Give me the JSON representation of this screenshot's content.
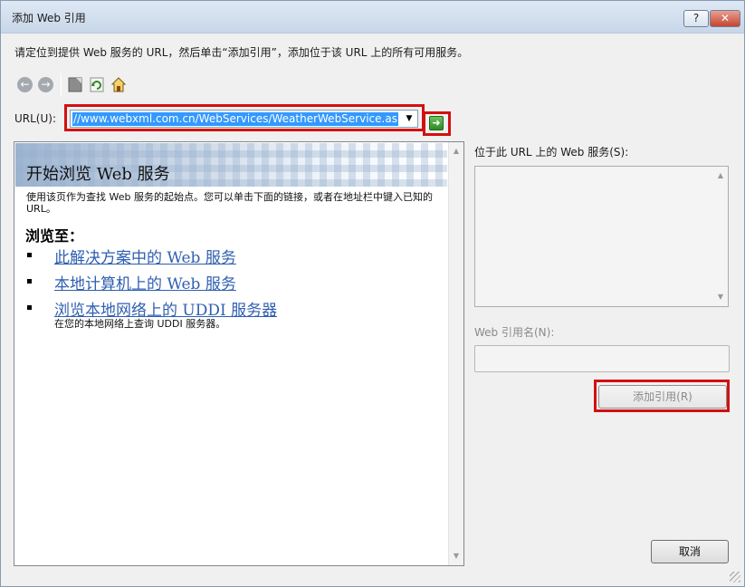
{
  "window": {
    "title": "添加 Web 引用",
    "help_glyph": "?",
    "close_glyph": "✕"
  },
  "instruction": "请定位到提供 Web 服务的 URL，然后单击“添加引用”，添加位于该 URL 上的所有可用服务。",
  "toolbar": {
    "back_glyph": "←",
    "forward_glyph": "→"
  },
  "url": {
    "label": "URL(U):",
    "value": "//www.webxml.com.cn/WebServices/WeatherWebService.asmx",
    "dropdown_glyph": "▼",
    "go_glyph": "➜"
  },
  "browser": {
    "heading": "开始浏览 Web 服务",
    "intro": "使用该页作为查找 Web 服务的起始点。您可以单击下面的链接，或者在地址栏中键入已知的 URL。",
    "browse_to": "浏览至：",
    "links": [
      {
        "label": "此解决方案中的 Web 服务"
      },
      {
        "label": "本地计算机上的 Web 服务"
      },
      {
        "label": "浏览本地网络上的 UDDI 服务器"
      }
    ],
    "link_sub": "在您的本地网络上查询 UDDI 服务器。",
    "scroll_up": "▲",
    "scroll_down": "▼"
  },
  "services": {
    "label": "位于此 URL 上的 Web 服务(S):",
    "scroll_up": "▲",
    "scroll_down": "▼"
  },
  "refname": {
    "label": "Web 引用名(N):",
    "value": ""
  },
  "buttons": {
    "add_reference": "添加引用(R)",
    "cancel": "取消"
  },
  "colors": {
    "highlight": "#d21010",
    "selection": "#3399ff",
    "link": "#2f5fb0"
  }
}
